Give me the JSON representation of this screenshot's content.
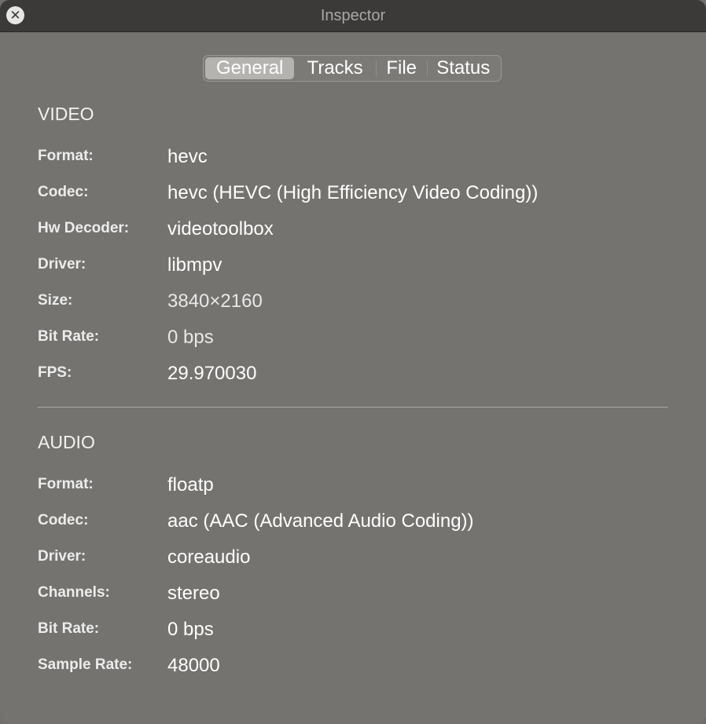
{
  "window": {
    "title": "Inspector"
  },
  "tabs": [
    {
      "label": "General",
      "active": true
    },
    {
      "label": "Tracks",
      "active": false
    },
    {
      "label": "File",
      "active": false
    },
    {
      "label": "Status",
      "active": false
    }
  ],
  "video": {
    "heading": "VIDEO",
    "rows": [
      {
        "label": "Format:",
        "value": "hevc"
      },
      {
        "label": "Codec:",
        "value": "hevc (HEVC (High Efficiency Video Coding))"
      },
      {
        "label": "Hw Decoder:",
        "value": "videotoolbox"
      },
      {
        "label": "Driver:",
        "value": "libmpv"
      },
      {
        "label": "Size:",
        "value": "3840×2160"
      },
      {
        "label": "Bit Rate:",
        "value": "0 bps"
      },
      {
        "label": "FPS:",
        "value": "29.970030"
      }
    ]
  },
  "audio": {
    "heading": "AUDIO",
    "rows": [
      {
        "label": "Format:",
        "value": "floatp"
      },
      {
        "label": "Codec:",
        "value": "aac (AAC (Advanced Audio Coding))"
      },
      {
        "label": "Driver:",
        "value": "coreaudio"
      },
      {
        "label": "Channels:",
        "value": "stereo"
      },
      {
        "label": "Bit Rate:",
        "value": "0 bps"
      },
      {
        "label": "Sample Rate:",
        "value": "48000"
      }
    ]
  },
  "icons": {
    "close": "close-icon"
  },
  "colors": {
    "window_bg": "#74736f",
    "titlebar_bg": "#3b3a38",
    "tab_active_bg": "#b4b3b0"
  }
}
